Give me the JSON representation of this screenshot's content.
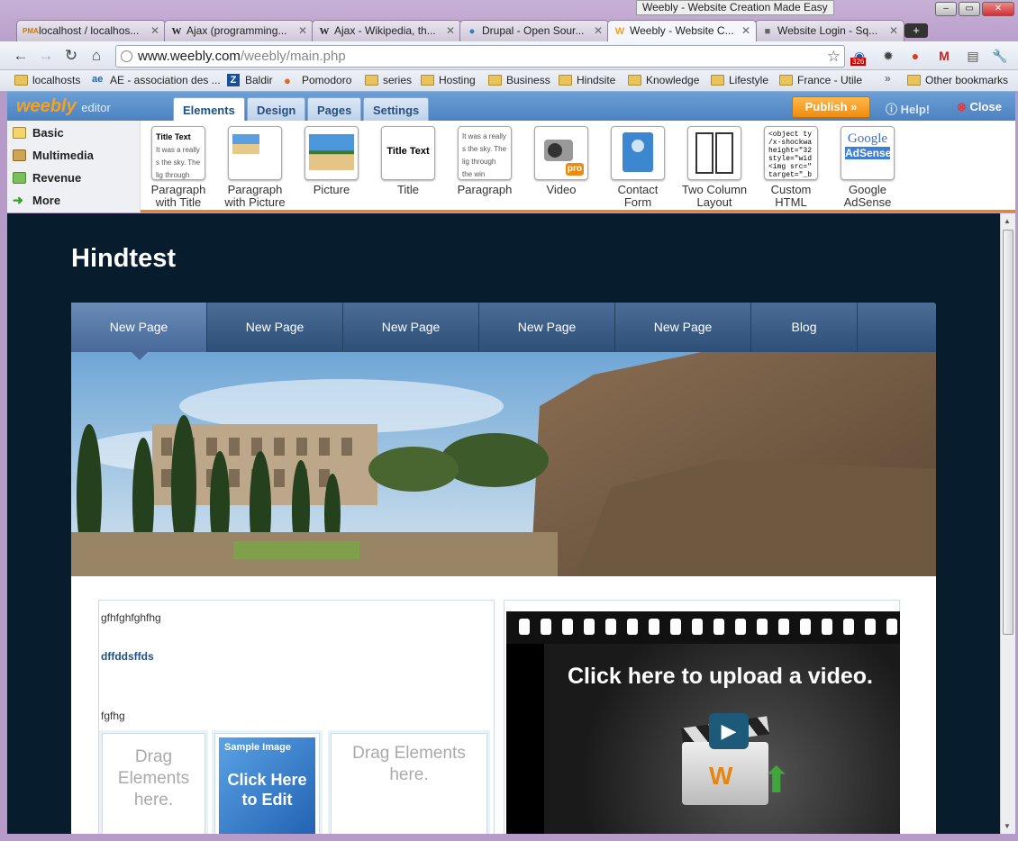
{
  "window": {
    "title": "Weebly - Website Creation Made Easy"
  },
  "tabs": [
    {
      "label": "localhost / localhos...",
      "icon": "pma"
    },
    {
      "label": "Ajax (programming...",
      "icon": "W"
    },
    {
      "label": "Ajax - Wikipedia, th...",
      "icon": "W"
    },
    {
      "label": "Drupal - Open Sour...",
      "icon": "drupal"
    },
    {
      "label": "Weebly - Website C...",
      "icon": "weebly"
    },
    {
      "label": "Website Login - Sq...",
      "icon": "box"
    }
  ],
  "address": {
    "host": "www.weebly.com",
    "path": "/weebly/main.php"
  },
  "extensions": {
    "badge": "326"
  },
  "bookmarks": [
    "localhosts",
    "AE - association des ...",
    "Baldir",
    "Pomodoro",
    "series",
    "Hosting",
    "Business",
    "Hindsite",
    "Knowledge",
    "Lifestyle",
    "France - Utile"
  ],
  "other_bookmarks": "Other bookmarks",
  "editor": {
    "logo": "weebly",
    "logo_suffix": "editor",
    "tabs": [
      "Elements",
      "Design",
      "Pages",
      "Settings"
    ],
    "publish": "Publish »",
    "help": "Help!",
    "close": "Close"
  },
  "categories": [
    "Basic",
    "Multimedia",
    "Revenue",
    "More"
  ],
  "elements": [
    {
      "line1": "Paragraph",
      "line2": "with Title"
    },
    {
      "line1": "Paragraph",
      "line2": "with Picture"
    },
    {
      "line1": "Picture",
      "line2": ""
    },
    {
      "line1": "Title",
      "line2": ""
    },
    {
      "line1": "Paragraph",
      "line2": ""
    },
    {
      "line1": "Video",
      "line2": ""
    },
    {
      "line1": "Contact",
      "line2": "Form"
    },
    {
      "line1": "Two Column",
      "line2": "Layout"
    },
    {
      "line1": "Custom",
      "line2": "HTML"
    },
    {
      "line1": "Google",
      "line2": "AdSense"
    }
  ],
  "thumbs": {
    "title_text": "Title Text",
    "sample_text": "It was a really s the sky. The lig through the win",
    "html_code": "<object ty /x-shockwa height=\"32 style=\"wid <img src=\" target=\"_b",
    "adsense_google": "Google",
    "adsense_word": "AdSense",
    "video_pro": "pro"
  },
  "site": {
    "title": "Hindtest",
    "nav": [
      "New Page",
      "New Page",
      "New Page",
      "New Page",
      "New Page",
      "Blog"
    ],
    "text1": "gfhfghfghfhg",
    "text2": "dffddsffds",
    "text3": "fgfhg",
    "drag1": "Drag Elements here.",
    "sample_image": "Sample Image",
    "click_edit": "Click Here to Edit",
    "drag2": "Drag Elements here.",
    "video_upload": "Click here to upload a video."
  }
}
